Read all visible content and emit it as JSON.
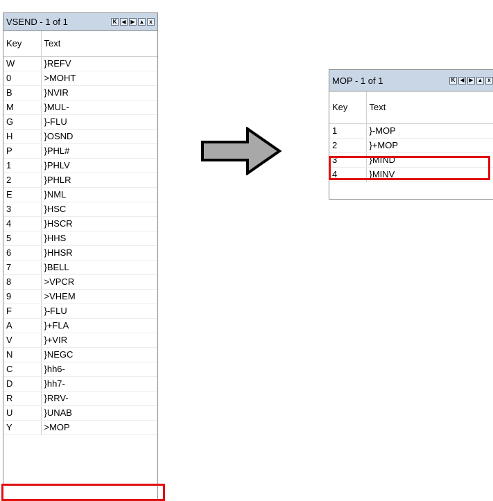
{
  "vsend": {
    "title": "VSEND  - 1 of 1",
    "headers": {
      "key": "Key",
      "text": "Text"
    },
    "rows": [
      {
        "key": "W",
        "text": "}REFV"
      },
      {
        "key": "0",
        "text": ">MOHT"
      },
      {
        "key": "B",
        "text": "}NVIR"
      },
      {
        "key": "M",
        "text": "}MUL-"
      },
      {
        "key": "G",
        "text": "}-FLU"
      },
      {
        "key": "H",
        "text": "}OSND"
      },
      {
        "key": "P",
        "text": "}PHL#"
      },
      {
        "key": "1",
        "text": "}PHLV"
      },
      {
        "key": "2",
        "text": "}PHLR"
      },
      {
        "key": "E",
        "text": "}NML"
      },
      {
        "key": "3",
        "text": "}HSC"
      },
      {
        "key": "4",
        "text": "}HSCR"
      },
      {
        "key": "5",
        "text": "}HHS"
      },
      {
        "key": "6",
        "text": "}HHSR"
      },
      {
        "key": "7",
        "text": "}BELL"
      },
      {
        "key": "8",
        "text": ">VPCR"
      },
      {
        "key": "9",
        "text": ">VHEM"
      },
      {
        "key": "F",
        "text": "}-FLU"
      },
      {
        "key": "A",
        "text": "}+FLA"
      },
      {
        "key": "V",
        "text": "}+VIR"
      },
      {
        "key": "N",
        "text": "}NEGC"
      },
      {
        "key": "C",
        "text": "}hh6-"
      },
      {
        "key": "D",
        "text": "}hh7-"
      },
      {
        "key": "R",
        "text": "}RRV-"
      },
      {
        "key": "U",
        "text": "}UNAB"
      },
      {
        "key": "Y",
        "text": ">MOP"
      }
    ],
    "highlighted_row_index": 25
  },
  "mop": {
    "title": "MOP  - 1 of 1",
    "headers": {
      "key": "Key",
      "text": "Text"
    },
    "rows": [
      {
        "key": "1",
        "text": "}-MOP"
      },
      {
        "key": "2",
        "text": "}+MOP"
      },
      {
        "key": "3",
        "text": "}MIND"
      },
      {
        "key": "4",
        "text": "}MINV"
      }
    ],
    "highlighted_row_index": 2
  },
  "nav_buttons": [
    {
      "icon": "first-record-icon",
      "glyph": "K"
    },
    {
      "icon": "previous-record-icon",
      "glyph": "◀"
    },
    {
      "icon": "next-record-icon",
      "glyph": "▶"
    },
    {
      "icon": "collapse-icon",
      "glyph": "▲"
    },
    {
      "icon": "close-icon",
      "glyph": "x"
    }
  ],
  "colors": {
    "titlebar": "#c9d6e6",
    "highlight": "#e01010",
    "arrow_fill": "#a8a8a8",
    "arrow_stroke": "#000000"
  }
}
